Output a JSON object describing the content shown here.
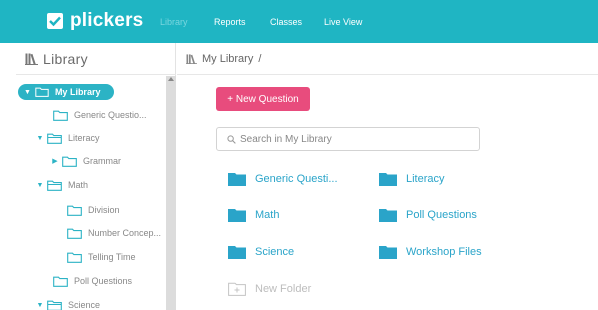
{
  "topbar": {
    "logo_text": "plickers",
    "nav": [
      "Library",
      "Reports",
      "Classes",
      "Live View"
    ],
    "active_nav": "Library",
    "bg_color": "#1fb5c3"
  },
  "sidebar": {
    "title": "Library",
    "title_icon": "library-books-icon",
    "items": [
      {
        "label": "My Library",
        "caret": "▼",
        "selected": true
      },
      {
        "label": "Generic Questio..."
      },
      {
        "label": "Literacy",
        "caret": "▼"
      },
      {
        "label": "Grammar",
        "caret": "▶"
      },
      {
        "label": "Math",
        "caret": "▼"
      },
      {
        "label": "Division"
      },
      {
        "label": "Number Concep..."
      },
      {
        "label": "Telling Time"
      },
      {
        "label": "Poll Questions"
      },
      {
        "label": "Science",
        "caret": "▼"
      }
    ]
  },
  "main": {
    "breadcrumb": "My Library",
    "breadcrumb_sep": "/",
    "new_question_label": "+ New Question",
    "search_placeholder": "Search in My Library",
    "folders": [
      {
        "label": "Generic Questi..."
      },
      {
        "label": "Literacy"
      },
      {
        "label": "Math"
      },
      {
        "label": "Poll Questions"
      },
      {
        "label": "Science"
      },
      {
        "label": "Workshop Files"
      }
    ],
    "new_folder_label": "New Folder"
  },
  "colors": {
    "accent": "#2cb3c5",
    "folder": "#2aa4c9",
    "button": "#e84c7d"
  }
}
